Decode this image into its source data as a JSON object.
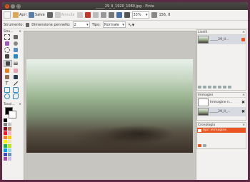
{
  "window": {
    "title": "_____29_II_1920_1080.jpg - Pinta"
  },
  "toolbar": {
    "open_label": "Apri",
    "save_label": "Salve",
    "undo_label": "Annulla",
    "zoom_value": "33%",
    "coords": "156, 8"
  },
  "options": {
    "tools_label": "Strumento:",
    "brush_label": "Dimensione pennello:",
    "brush_value": "2",
    "type_label": "Tipo:",
    "type_value": "Normale"
  },
  "left_panel": {
    "tools_title": "Stru...",
    "palette_title": "Tavol..."
  },
  "right_panel": {
    "layers_title": "Livelli",
    "layer_name": "_____29_II...",
    "images_title": "Immagini",
    "image_name": "Immagine n...",
    "image_file": "_____29_II_...",
    "history_title": "Cronologia",
    "history_item": "Apri immagine"
  },
  "palette": [
    "#000000",
    "#ffffff",
    "#7f7f7f",
    "#c3c3c3",
    "#880015",
    "#b97a57",
    "#ed1c24",
    "#ffaec9",
    "#ff7f27",
    "#ffc90e",
    "#fff200",
    "#efe4b0",
    "#22b14c",
    "#b5e61d",
    "#00a2e8",
    "#99d9ea",
    "#3f48cc",
    "#7092be",
    "#a349a4",
    "#c8bfe7"
  ],
  "colors": {
    "accent": "#e95420",
    "title_bg": "#3c3b37"
  }
}
